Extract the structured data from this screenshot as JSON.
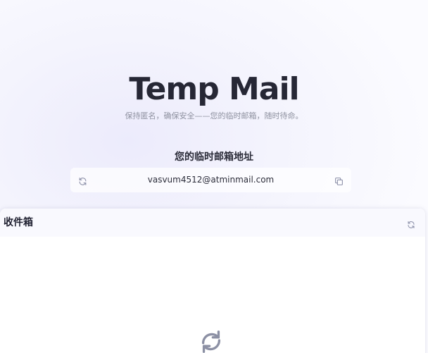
{
  "hero": {
    "title": "Temp Mail",
    "subtitle": "保持匿名，确保安全——您的临时邮箱，随时待命。"
  },
  "email": {
    "heading": "您的临时邮箱地址",
    "address": "vasvum4512@atminmail.com",
    "refresh_icon": "refresh-icon",
    "copy_icon": "copy-icon"
  },
  "inbox": {
    "title": "收件箱",
    "refresh_icon": "refresh-icon",
    "loading_icon": "loading-icon"
  },
  "colors": {
    "title": "#262735",
    "subtitle": "#8f92a0",
    "icon": "#8b8fa8"
  }
}
